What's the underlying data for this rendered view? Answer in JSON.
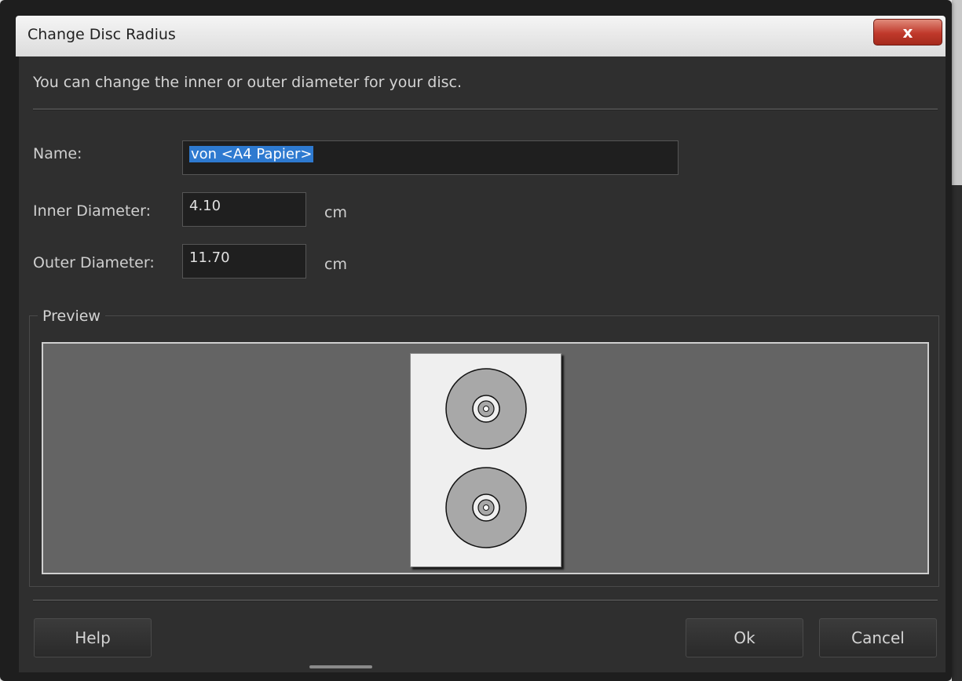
{
  "window": {
    "title": "Change Disc Radius",
    "close_label": "x"
  },
  "description": "You can change the inner or outer diameter for your disc.",
  "form": {
    "name_label": "Name:",
    "name_value": "von <A4 Papier>",
    "inner_label": "Inner Diameter:",
    "inner_value": "4.10",
    "inner_unit": "cm",
    "outer_label": "Outer Diameter:",
    "outer_value": "11.70",
    "outer_unit": "cm"
  },
  "preview": {
    "label": "Preview",
    "discs": [
      {
        "name": "disc-top"
      },
      {
        "name": "disc-bottom"
      }
    ]
  },
  "buttons": {
    "help": "Help",
    "ok": "Ok",
    "cancel": "Cancel"
  },
  "colors": {
    "client_bg": "#2f2f2f",
    "preview_bg": "#646464",
    "selection": "#2e7ad0",
    "close_red": "#c0392b"
  }
}
